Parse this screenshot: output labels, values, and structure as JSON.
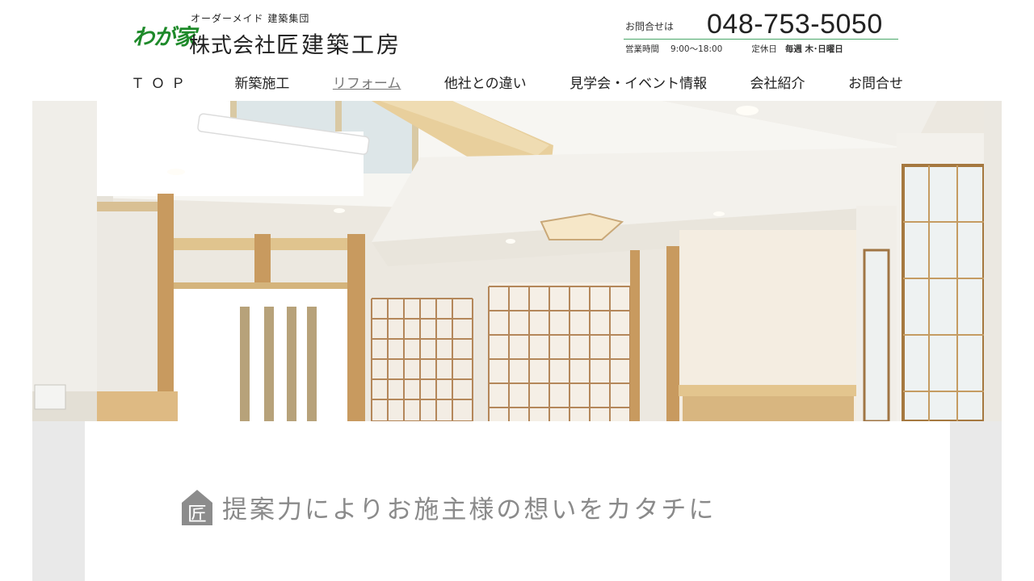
{
  "logo": {
    "waga": "わが家",
    "tagline": "オーダーメイド 建築集団",
    "company_prefix": "株式会社",
    "company_name": "匠建築工房"
  },
  "contact": {
    "label": "お問合せは",
    "phone": "048-753-5050",
    "hours_label": "営業時間",
    "hours_value": "9:00〜18:00",
    "closed_label": "定休日",
    "closed_value": "毎週 木･日曜日"
  },
  "nav": {
    "items": [
      {
        "label": "ＴＯＰ"
      },
      {
        "label": "新築施工"
      },
      {
        "label": "リフォーム"
      },
      {
        "label": "他社との違い"
      },
      {
        "label": "見学会・イベント情報"
      },
      {
        "label": "会社紹介"
      },
      {
        "label": "お問合せ"
      }
    ],
    "active_index": 2
  },
  "section": {
    "icon_char": "匠",
    "heading": "提案力によりお施主様の想いをカタチに"
  },
  "colors": {
    "brand_green": "#1e8a2a",
    "divider_green": "#4aa86a",
    "heading_gray": "#8a8a8a"
  }
}
